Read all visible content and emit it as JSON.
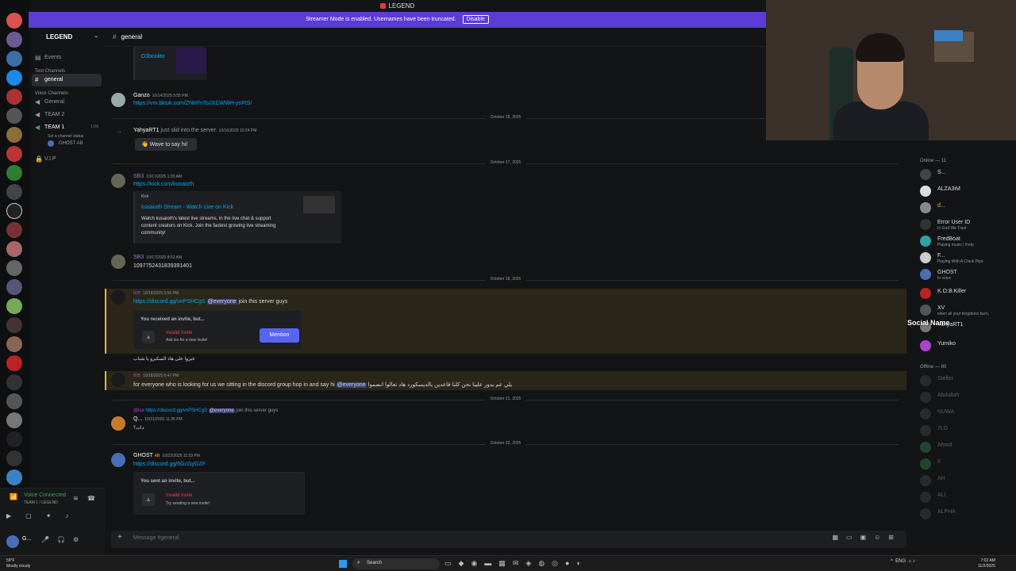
{
  "window": {
    "title": "LEGEND"
  },
  "banner": {
    "text": "Streamer Mode is enabled. Usernames have been truncated.",
    "button": "Disable"
  },
  "server": {
    "name": "LEGEND"
  },
  "sidebar": {
    "events": "Events",
    "text_category": "Text Channels",
    "text_channels": [
      "general"
    ],
    "voice_category": "Voice Channels",
    "voice_channels": [
      "General",
      "TEAM 2",
      "TEAM 1",
      "V.I.P"
    ],
    "team1_timer": "1:06",
    "team1_status": "Set a channel status",
    "team1_member": "GHOST",
    "team1_member_badge": "AB"
  },
  "header": {
    "channel": "general"
  },
  "messages": {
    "top_embed_name": "D3boolito",
    "ganzo_name": "Ganzo",
    "ganzo_time": "10/14/2025 9:55 PM",
    "ganzo_link": "https://vm.tiktok.com/ZNH7nToJXCWWH-jmFtS/",
    "div1": "October 16, 2025",
    "yahya_name": "YahyaRT1",
    "yahya_text": "just slid into the server.",
    "yahya_time": "10/16/2025 10:24 PM",
    "wave": "Wave to say hi!",
    "div2": "October 17, 2025",
    "sb3_name": "SB3",
    "sb3_time1": "10/17/2025 1:20 AM",
    "sb3_link": "https://kick.com/kusaioth",
    "kick_provider": "Kick",
    "kick_title": "kusaioth Stream - Watch Live on Kick",
    "kick_desc_1": "Watch kusaioth's latest live streams, in the live chat & support",
    "kick_desc_2": "content creators on Kick. Join the fastest growing live streaming",
    "kick_desc_3": "community!",
    "sb3_time2": "10/17/2025 8:53 AM",
    "sb3_text2": "1097752431839391401",
    "div3": "October 18, 2025",
    "ice_name": "ice",
    "ice_time1": "10/18/2025 5:56 PM",
    "ice_link": "https://discord.gg/vnPSHCgS",
    "everyone": "@everyone",
    "ice_text1": "join this server guys",
    "invite_label": "You received an invite, but...",
    "invalid": "Invalid Invite",
    "ask_ice": "Ask ice for a new invite!",
    "mention_btn": "Mention",
    "arabic1": "غيروا على هاد السكيرو يا شباب",
    "ice_time2": "10/18/2025 6:47 PM",
    "ice_text2": "for everyone who is looking for us we sitting in the discord group hop in and say hi",
    "arabic2": "يلي عم يدور علينا نحن كلنا قاعدين بالديسكورد هاد تعالوا انضموا",
    "div4": "October 21, 2025",
    "reply_name": "@ice",
    "reply_link": "https://discord.gg/vnPSHCgS",
    "reply_text": "join this server guys",
    "q_name": "Q...",
    "q_time": "10/21/2025 11:35 PM",
    "q_text": "دات؟",
    "div5": "October 22, 2025",
    "ghost_name": "GHOST",
    "ghost_badge": "AB",
    "ghost_time": "10/22/2025 11:53 PM",
    "ghost_link": "https://discord.gg/6GcGyGZF",
    "sent_label": "You sent an invite, but...",
    "try_new": "Try sending a new invite!"
  },
  "composer": {
    "placeholder": "Message #general"
  },
  "voice": {
    "status": "Voice Connected",
    "channel": "TEAM 1 / LEGEND"
  },
  "user": {
    "name": "G..."
  },
  "members": {
    "online_header": "Online — 11",
    "offline_header": "Offline — 80",
    "online": [
      {
        "name": "S...",
        "status": ""
      },
      {
        "name": "ALZA3iM",
        "status": ""
      },
      {
        "name": "d...",
        "status": ""
      },
      {
        "name": "Error User ID",
        "status": "In God We Trust"
      },
      {
        "name": "FredBoat",
        "status": "Playing music | /help"
      },
      {
        "name": "F...",
        "status": "Playing With A Crack Pipe"
      },
      {
        "name": "GHOST",
        "status": "In voice"
      },
      {
        "name": "K.O.B.Killer",
        "status": ""
      },
      {
        "name": "XV",
        "status": "when all your kingdoms burn,"
      },
      {
        "name": "YahyaRT1",
        "status": ""
      },
      {
        "name": "Yumiko",
        "status": ""
      }
    ],
    "offline": [
      {
        "name": "Steller"
      },
      {
        "name": "Abdullah"
      },
      {
        "name": "NUWA"
      },
      {
        "name": "7LG"
      },
      {
        "name": "Ahmd"
      },
      {
        "name": "K"
      },
      {
        "name": "AH"
      },
      {
        "name": "ALI"
      },
      {
        "name": "ALPHA"
      }
    ]
  },
  "overlay": {
    "social_name": "Social Name"
  },
  "taskbar": {
    "weather_temp": "59°F",
    "weather_desc": "Mostly cloudy",
    "search": "Search",
    "lang": "ENG",
    "time": "7:02 AM",
    "date": "11/2/2025"
  }
}
